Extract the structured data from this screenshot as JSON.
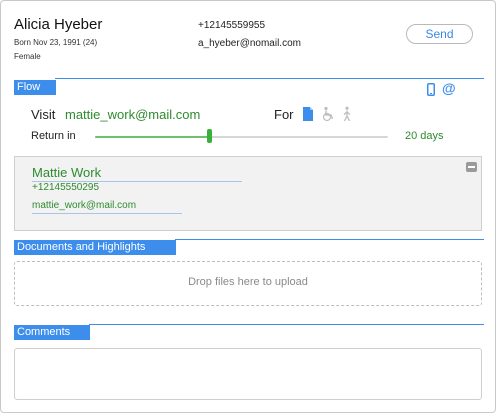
{
  "patient": {
    "name": "Alicia Hyeber",
    "dob": "Born Nov 23, 1991 (24)",
    "sex": "Female",
    "phone": "+12145559955",
    "email": "a_hyeber@nomail.com"
  },
  "header": {
    "send_label": "Send"
  },
  "sections": {
    "flow": "Flow",
    "documents": "Documents and Highlights",
    "comments": "Comments"
  },
  "flow": {
    "channel_icons": [
      "phone-icon",
      "at-icon"
    ],
    "at_glyph": "@",
    "visit_label": "Visit",
    "visit_value": "mattie_work@mail.com",
    "for_label": "For",
    "for_icons": [
      "document-icon",
      "wheelchair-icon",
      "walking-icon"
    ],
    "return_label": "Return in",
    "return_value": "20 days",
    "return_fraction": 0.39
  },
  "contact": {
    "name": "Mattie Work",
    "phone": "+12145550295",
    "email": "mattie_work@mail.com"
  },
  "documents": {
    "dropzone_text": "Drop files here to upload"
  },
  "comments": {
    "value": ""
  },
  "colors": {
    "accent": "#3d8eec",
    "success": "#2e8b2e",
    "slider_thumb": "#3ab03a"
  }
}
